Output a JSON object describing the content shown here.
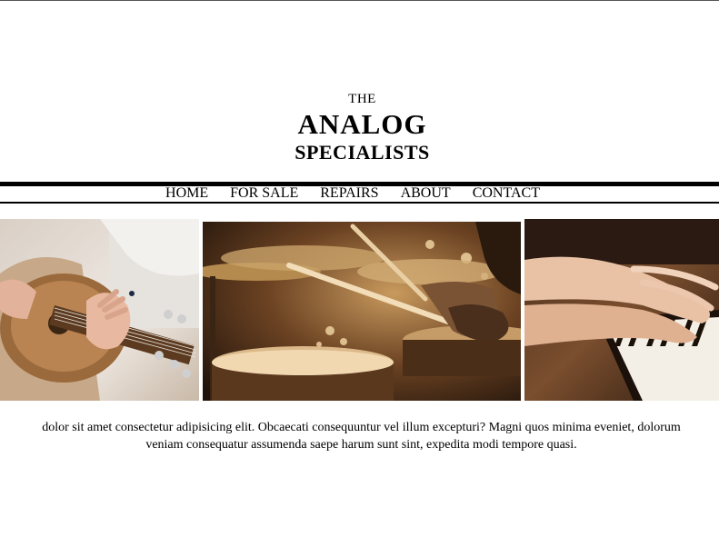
{
  "brand": {
    "the": "THE",
    "name": "ANALOG",
    "tagline": "SPECIALISTS"
  },
  "nav": {
    "items": [
      {
        "label": "HOME"
      },
      {
        "label": "FOR SALE"
      },
      {
        "label": "REPAIRS"
      },
      {
        "label": "ABOUT"
      },
      {
        "label": "CONTACT"
      }
    ]
  },
  "gallery": {
    "images": [
      {
        "subject": "guitar-player"
      },
      {
        "subject": "drummer"
      },
      {
        "subject": "pianist"
      }
    ]
  },
  "intro": {
    "line1": "dolor sit amet consectetur adipisicing elit. Obcaecati consequuntur vel illum excepturi? Magni quos minima eveniet, dolorum",
    "line2": "veniam consequatur assumenda saepe harum sunt sint, expedita modi tempore quasi."
  }
}
